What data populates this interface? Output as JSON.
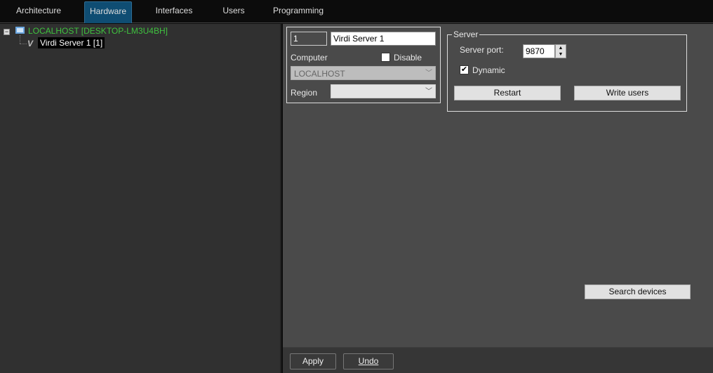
{
  "tabs": [
    {
      "label": "Architecture"
    },
    {
      "label": "Hardware"
    },
    {
      "label": "Interfaces"
    },
    {
      "label": "Users"
    },
    {
      "label": "Programming"
    }
  ],
  "tree": {
    "root": "LOCALHOST [DESKTOP-LM3U4BH]",
    "child": "Virdi Server 1 [1]",
    "collapse": "−"
  },
  "device": {
    "id": "1",
    "name": "Virdi Server 1",
    "computer_label": "Computer",
    "disable_label": "Disable",
    "computer_value": "LOCALHOST",
    "region_label": "Region",
    "region_value": ""
  },
  "server": {
    "legend": "Server",
    "port_label": "Server port:",
    "port_value": "9870",
    "dynamic_label": "Dynamic",
    "dynamic_check": "✔",
    "restart": "Restart",
    "write_users": "Write users"
  },
  "search_devices": "Search devices",
  "footer": {
    "apply": "Apply",
    "undo": "Undo"
  },
  "colors": {
    "accent": "#0f4d73",
    "tree_root": "#3fc23f"
  }
}
